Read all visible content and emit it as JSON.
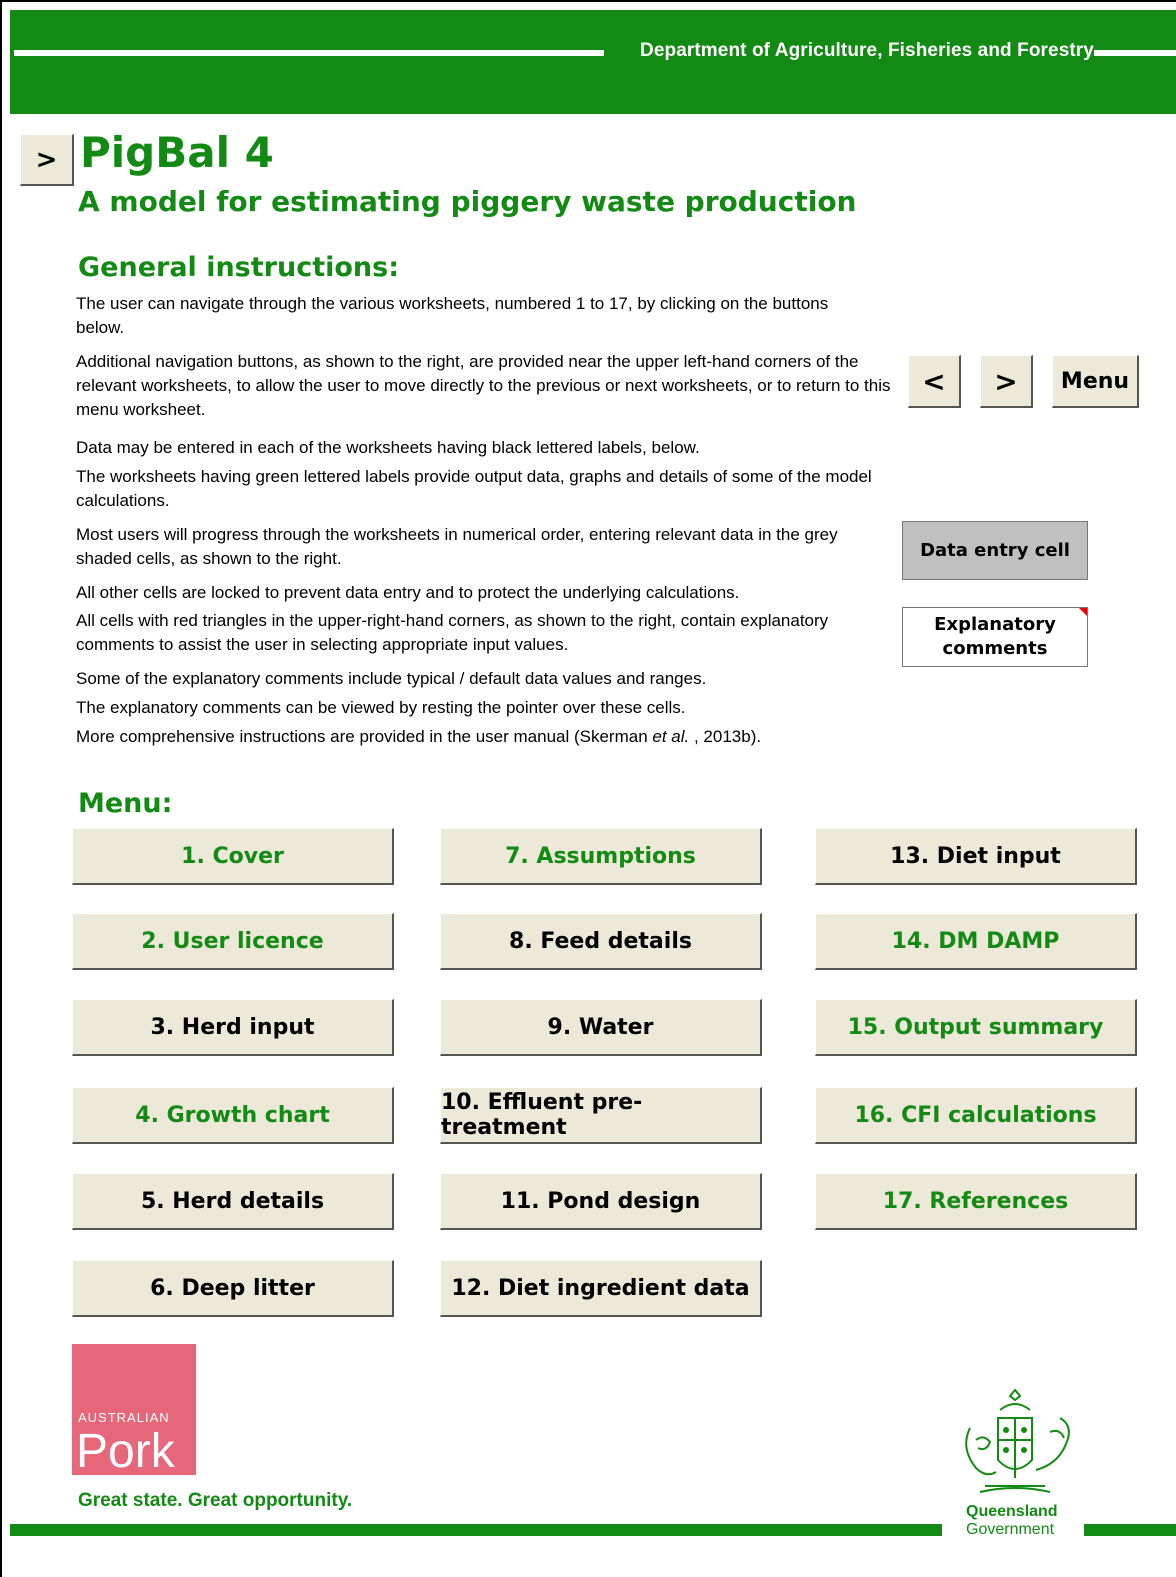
{
  "header": {
    "department": "Department of Agriculture, Fisheries and Forestry"
  },
  "nav": {
    "next": ">",
    "prev": "<",
    "menu": "Menu"
  },
  "title": "PigBal 4",
  "subtitle": "A model for estimating piggery waste production",
  "instructions": {
    "heading": "General instructions:",
    "p1": "The user can navigate through the various worksheets, numbered 1 to 17, by clicking on the buttons below.",
    "p2": "Additional navigation buttons, as shown to the right, are provided near the upper left-hand corners of the relevant worksheets, to allow the user to move directly to the previous or next worksheets, or to return to this menu worksheet.",
    "p3": "Data may be entered in each of the worksheets having black lettered labels, below.",
    "p4": "The worksheets having green lettered labels provide output data, graphs and details of some of the model calculations.",
    "p5": "Most users will progress through the worksheets in numerical order, entering relevant data in the grey shaded cells, as shown to the right.",
    "p6": "All other cells are locked to prevent data entry and to protect the underlying calculations.",
    "p7": "All cells with red triangles in the upper-right-hand corners, as shown to the right, contain explanatory comments to assist the user in selecting appropriate input values.",
    "p8": "Some of the explanatory comments include typical / default data values and ranges.",
    "p9": "The explanatory comments can be viewed by resting the pointer over these cells.",
    "p10_a": "More comprehensive instructions are provided in the user manual (Skerman ",
    "p10_b": "et al.",
    "p10_c": " , 2013b)."
  },
  "samples": {
    "data_entry": "Data entry cell",
    "explanatory_1": "Explanatory",
    "explanatory_2": "comments"
  },
  "menu": {
    "heading": "Menu:",
    "items": [
      {
        "label": "1. Cover",
        "color": "green"
      },
      {
        "label": "2. User licence",
        "color": "green"
      },
      {
        "label": "3. Herd input",
        "color": "black"
      },
      {
        "label": "4. Growth chart",
        "color": "green"
      },
      {
        "label": "5. Herd details",
        "color": "black"
      },
      {
        "label": "6. Deep litter",
        "color": "black"
      },
      {
        "label": "7. Assumptions",
        "color": "green"
      },
      {
        "label": "8. Feed details",
        "color": "black"
      },
      {
        "label": "9. Water",
        "color": "black"
      },
      {
        "label": "10. Effluent pre-treatment",
        "color": "black"
      },
      {
        "label": "11. Pond design",
        "color": "black"
      },
      {
        "label": "12. Diet ingredient data",
        "color": "black"
      },
      {
        "label": "13. Diet input",
        "color": "black"
      },
      {
        "label": "14. DM DAMP",
        "color": "green"
      },
      {
        "label": "15. Output summary",
        "color": "green"
      },
      {
        "label": "16. CFI calculations",
        "color": "green"
      },
      {
        "label": "17. References",
        "color": "green"
      }
    ]
  },
  "footer": {
    "pork_small": "AUSTRALIAN",
    "pork_big": "Pork",
    "slogan": "Great state. Great opportunity.",
    "qld_1": "Queensland",
    "qld_2": "Government"
  },
  "colors": {
    "brand_green": "#138a13",
    "button_bg": "#ece9d8",
    "pork_pink": "#e6677a",
    "data_entry_grey": "#c0c0c0"
  }
}
